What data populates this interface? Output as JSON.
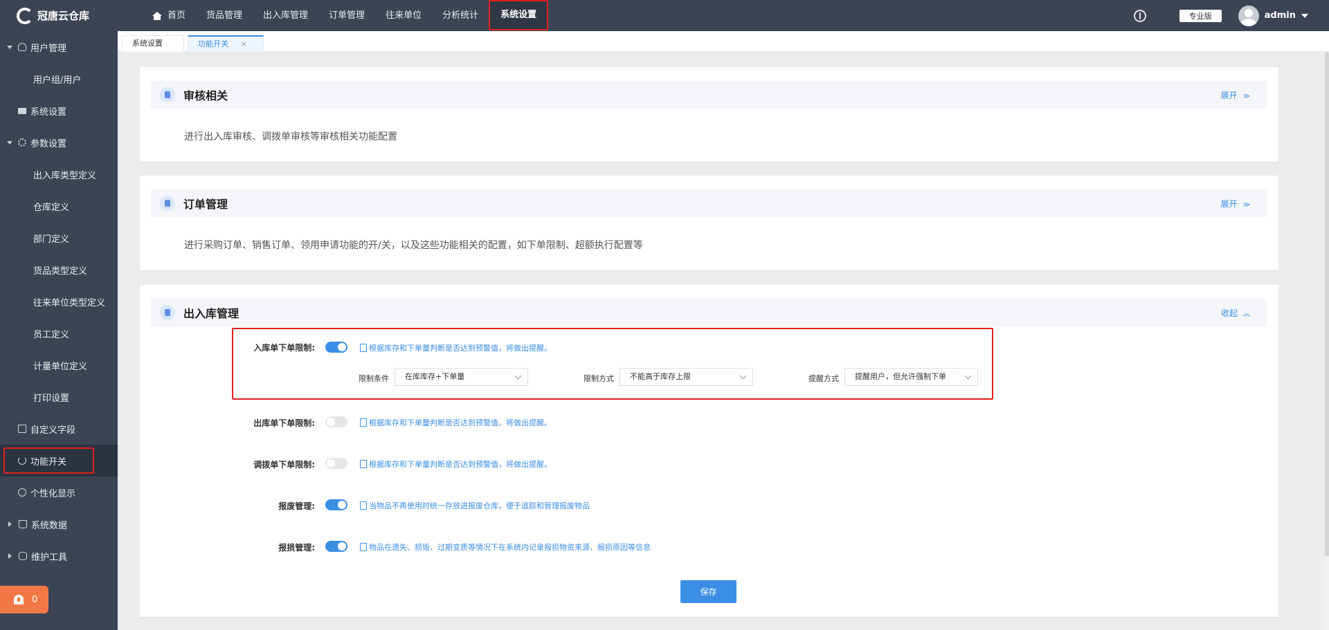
{
  "app": {
    "logo_text": "冠唐云仓库"
  },
  "topnav": {
    "items": [
      {
        "label": "首页",
        "icon": "home-icon"
      },
      {
        "label": "货品管理"
      },
      {
        "label": "出入库管理"
      },
      {
        "label": "订单管理"
      },
      {
        "label": "往来单位"
      },
      {
        "label": "分析统计"
      },
      {
        "label": "系统设置",
        "active": true
      }
    ],
    "edition": "专业版",
    "username": "admin"
  },
  "sidebar": {
    "items": [
      {
        "label": "用户管理",
        "level": 1,
        "arrow": "down",
        "icon": "user-icon"
      },
      {
        "label": "用户组/用户",
        "level": 2
      },
      {
        "label": "系统设置",
        "level": 1,
        "icon": "monitor-icon"
      },
      {
        "label": "参数设置",
        "level": 1,
        "arrow": "down",
        "icon": "gear-icon"
      },
      {
        "label": "出入库类型定义",
        "level": 2
      },
      {
        "label": "仓库定义",
        "level": 2
      },
      {
        "label": "部门定义",
        "level": 2
      },
      {
        "label": "货品类型定义",
        "level": 2
      },
      {
        "label": "往来单位类型定义",
        "level": 2
      },
      {
        "label": "员工定义",
        "level": 2
      },
      {
        "label": "计量单位定义",
        "level": 2
      },
      {
        "label": "打印设置",
        "level": 2
      },
      {
        "label": "自定义字段",
        "level": 1,
        "icon": "form-icon"
      },
      {
        "label": "功能开关",
        "level": 1,
        "icon": "power-icon",
        "active": true
      },
      {
        "label": "个性化显示",
        "level": 1,
        "icon": "palette-icon"
      },
      {
        "label": "系统数据",
        "level": 1,
        "arrow": "right",
        "icon": "cart-icon"
      },
      {
        "label": "维护工具",
        "level": 1,
        "arrow": "right",
        "icon": "database-icon"
      }
    ],
    "alert_count": "0"
  },
  "tabs": {
    "items": [
      {
        "label": "系统设置"
      },
      {
        "label": "功能开关",
        "active": true,
        "close": "×"
      }
    ]
  },
  "cards": {
    "audit": {
      "title": "审核相关",
      "toggle": "展开",
      "toggle_chevron": "≫",
      "desc": "进行出入库审核、调拨单审核等审核相关功能配置"
    },
    "order": {
      "title": "订单管理",
      "toggle": "展开",
      "toggle_chevron": "≫",
      "desc": "进行采购订单、销售订单、领用申请功能的开/关，以及这些功能相关的配置，如下单限制、超额执行配置等"
    },
    "stock": {
      "title": "出入库管理",
      "toggle": "收起",
      "toggle_chevron": "︽",
      "rows": [
        {
          "label": "入库单下单限制:",
          "on": true,
          "hint": "根据库存和下单量判断是否达到预警值，将做出提醒。"
        },
        {
          "label": "出库单下单限制:",
          "on": false,
          "hint": "根据库存和下单量判断是否达到预警值，将做出提醒。"
        },
        {
          "label": "调拨单下单限制:",
          "on": false,
          "hint": "根据库存和下单量判断是否达到预警值，将做出提醒。"
        },
        {
          "label": "报废管理:",
          "on": true,
          "hint": "当物品不再使用时统一存放进报废仓库，便于追踪和管理报废物品"
        },
        {
          "label": "报损管理:",
          "on": true,
          "hint": "物品在遗失、损毁、过期变质等情况下在系统内记录报损物资来源、报损原因等信息"
        }
      ],
      "sub_settings": {
        "condition_label": "限制条件",
        "condition_value": "在库库存+下单量",
        "method_label": "限制方式",
        "method_value": "不能高于库存上限",
        "remind_label": "提醒方式",
        "remind_value": "提醒用户，但允许强制下单"
      },
      "save": "保存"
    }
  },
  "colors": {
    "accent": "#3a8ee6",
    "sidebar_bg": "#3c4454",
    "highlight": "#e02020",
    "alert": "#f07846"
  }
}
